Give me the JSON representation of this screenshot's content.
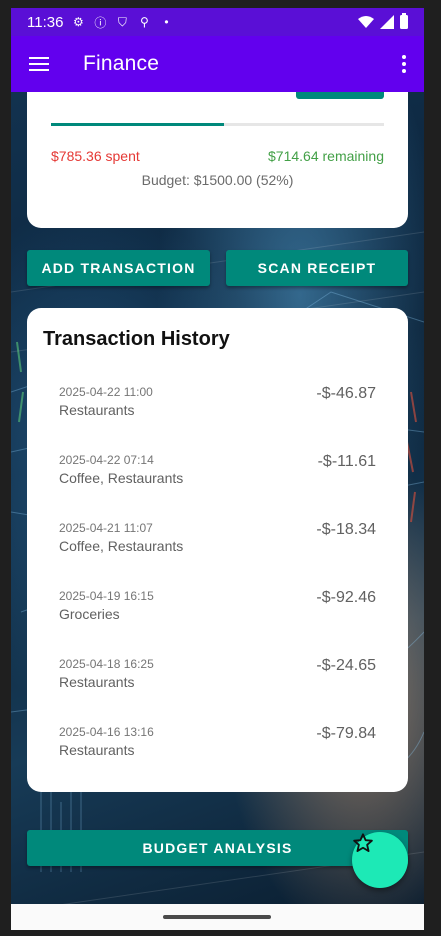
{
  "status_bar": {
    "time": "11:36",
    "icons": [
      "gear-icon",
      "info-icon",
      "shield-icon",
      "usb-icon",
      "dot-icon"
    ],
    "right_icons": [
      "wifi-icon",
      "signal-icon",
      "battery-icon"
    ]
  },
  "app_bar": {
    "title": "Finance",
    "menu_icon": "hamburger-menu-icon",
    "overflow_icon": "more-vert-icon"
  },
  "budget": {
    "spent_text": "$785.36 spent",
    "remaining_text": "$714.64 remaining",
    "budget_text": "Budget: $1500.00 (52%)",
    "progress_percent": 52
  },
  "actions": {
    "add_transaction": "ADD TRANSACTION",
    "scan_receipt": "SCAN RECEIPT",
    "budget_analysis": "BUDGET ANALYSIS"
  },
  "history": {
    "title": "Transaction History",
    "transactions": [
      {
        "date": "2025-04-22 11:00",
        "category": "Restaurants",
        "amount": "-$-46.87"
      },
      {
        "date": "2025-04-22 07:14",
        "category": "Coffee, Restaurants",
        "amount": "-$-11.61"
      },
      {
        "date": "2025-04-21 11:07",
        "category": "Coffee, Restaurants",
        "amount": "-$-18.34"
      },
      {
        "date": "2025-04-19 16:15",
        "category": "Groceries",
        "amount": "-$-92.46"
      },
      {
        "date": "2025-04-18 16:25",
        "category": "Restaurants",
        "amount": "-$-24.65"
      },
      {
        "date": "2025-04-16 13:16",
        "category": "Restaurants",
        "amount": "-$-79.84"
      }
    ]
  },
  "fab": {
    "icon": "star-outline-icon"
  },
  "colors": {
    "status_bar": "#5a0fd6",
    "app_bar": "#6200ee",
    "accent_teal": "#00897b",
    "fab": "#1de9b6",
    "spent": "#e53935",
    "remaining": "#43a047"
  }
}
